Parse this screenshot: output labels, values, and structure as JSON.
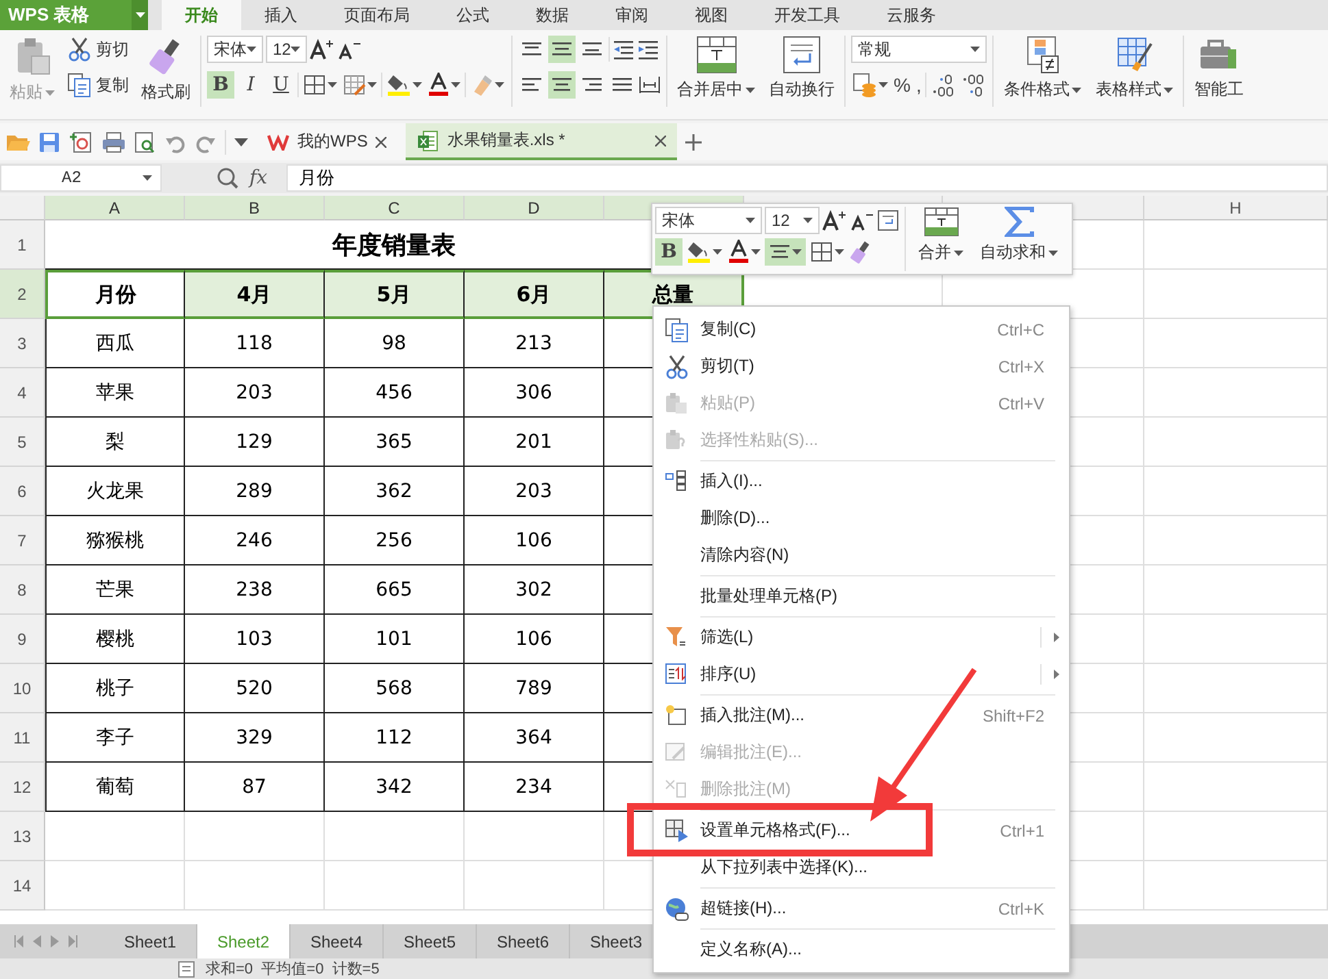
{
  "app_button": {
    "label": "WPS 表格"
  },
  "ribbon_tabs": [
    {
      "label": "开始",
      "selected": true
    },
    {
      "label": "插入",
      "selected": false
    },
    {
      "label": "页面布局",
      "selected": false
    },
    {
      "label": "公式",
      "selected": false
    },
    {
      "label": "数据",
      "selected": false
    },
    {
      "label": "审阅",
      "selected": false
    },
    {
      "label": "视图",
      "selected": false
    },
    {
      "label": "开发工具",
      "selected": false
    },
    {
      "label": "云服务",
      "selected": false
    }
  ],
  "ribbon": {
    "paste": "粘贴",
    "cut": "剪切",
    "copy": "复制",
    "format_painter": "格式刷",
    "font": "宋体",
    "size": "12",
    "font_style_buttons": [
      {
        "label": "B",
        "selected": true
      },
      {
        "label": "I",
        "selected": false
      },
      {
        "label": "U",
        "selected": false
      }
    ],
    "vertical_align": [
      {
        "selected": false
      },
      {
        "selected": true
      },
      {
        "selected": false
      }
    ],
    "horizontal_align": [
      {
        "selected": false
      },
      {
        "selected": true
      },
      {
        "selected": false
      },
      {
        "selected": false
      }
    ],
    "merge": "合并居中",
    "wrap": "自动换行",
    "number_format": "常规",
    "percent": "%",
    "comma": ",",
    "conditional_format": "条件格式",
    "table_style": "表格样式",
    "smart_tools": "智能工"
  },
  "doc_tabs": [
    {
      "label": "我的WPS",
      "selected": false
    },
    {
      "label": "水果销量表.xls *",
      "selected": true
    }
  ],
  "formula_bar": {
    "name_box": "A2",
    "function_label": "fx",
    "formula": "月份"
  },
  "sheet": {
    "columns": [
      {
        "label": "A",
        "selected": true
      },
      {
        "label": "B",
        "selected": true
      },
      {
        "label": "C",
        "selected": true
      },
      {
        "label": "D",
        "selected": true
      },
      {
        "selected": true
      },
      {
        "selected": false
      },
      {
        "selected": false
      },
      {
        "label": "H",
        "selected": false
      }
    ],
    "row_numbers": [
      {
        "label": "1",
        "selected": false
      },
      {
        "label": "2",
        "selected": true
      },
      {
        "label": "3",
        "selected": false
      },
      {
        "label": "4",
        "selected": false
      },
      {
        "label": "5",
        "selected": false
      },
      {
        "label": "6",
        "selected": false
      },
      {
        "label": "7",
        "selected": false
      },
      {
        "label": "8",
        "selected": false
      },
      {
        "label": "9",
        "selected": false
      },
      {
        "label": "10",
        "selected": false
      },
      {
        "label": "11",
        "selected": false
      },
      {
        "label": "12",
        "selected": false
      },
      {
        "label": "13",
        "selected": false
      },
      {
        "label": "14",
        "selected": false
      }
    ],
    "title": "年度销量表",
    "header": {
      "selected": true,
      "cells": [
        "月份",
        "4月",
        "5月",
        "6月",
        "总量"
      ]
    },
    "rows": [
      [
        "西瓜",
        "118",
        "98",
        "213"
      ],
      [
        "苹果",
        "203",
        "456",
        "306"
      ],
      [
        "梨",
        "129",
        "365",
        "201"
      ],
      [
        "火龙果",
        "289",
        "362",
        "203"
      ],
      [
        "猕猴桃",
        "246",
        "256",
        "106"
      ],
      [
        "芒果",
        "238",
        "665",
        "302"
      ],
      [
        "樱桃",
        "103",
        "101",
        "106"
      ],
      [
        "桃子",
        "520",
        "568",
        "789"
      ],
      [
        "李子",
        "329",
        "112",
        "364"
      ],
      [
        "葡萄",
        "87",
        "342",
        "234"
      ]
    ]
  },
  "mini_toolbar": {
    "font": "宋体",
    "size": "12",
    "bold": {
      "label": "B",
      "selected": true
    },
    "align_center": true,
    "merge": "合并",
    "autosum": "自动求和"
  },
  "context_menu": [
    {
      "kind": "item",
      "label": "复制(C)",
      "shortcut": "Ctrl+C",
      "disabled": false,
      "submenu": false
    },
    {
      "kind": "item",
      "label": "剪切(T)",
      "shortcut": "Ctrl+X",
      "disabled": false,
      "submenu": false
    },
    {
      "kind": "item",
      "label": "粘贴(P)",
      "shortcut": "Ctrl+V",
      "disabled": true,
      "submenu": false
    },
    {
      "kind": "item",
      "label": "选择性粘贴(S)...",
      "disabled": true,
      "submenu": false
    },
    {
      "kind": "separator"
    },
    {
      "kind": "item",
      "label": "插入(I)...",
      "disabled": false,
      "submenu": false
    },
    {
      "kind": "item",
      "label": "删除(D)...",
      "disabled": false,
      "submenu": false
    },
    {
      "kind": "item",
      "label": "清除内容(N)",
      "disabled": false,
      "submenu": false
    },
    {
      "kind": "separator"
    },
    {
      "kind": "item",
      "label": "批量处理单元格(P)",
      "disabled": false,
      "submenu": false
    },
    {
      "kind": "separator"
    },
    {
      "kind": "item",
      "label": "筛选(L)",
      "disabled": false,
      "submenu": true
    },
    {
      "kind": "item",
      "label": "排序(U)",
      "disabled": false,
      "submenu": true
    },
    {
      "kind": "separator"
    },
    {
      "kind": "item",
      "label": "插入批注(M)...",
      "shortcut": "Shift+F2",
      "disabled": false,
      "submenu": false
    },
    {
      "kind": "item",
      "label": "编辑批注(E)...",
      "disabled": true,
      "submenu": false
    },
    {
      "kind": "item",
      "label": "删除批注(M)",
      "disabled": true,
      "submenu": false
    },
    {
      "kind": "separator"
    },
    {
      "kind": "item",
      "label": "设置单元格格式(F)...",
      "shortcut": "Ctrl+1",
      "disabled": false,
      "submenu": false
    },
    {
      "kind": "item",
      "label": "从下拉列表中选择(K)...",
      "disabled": false,
      "submenu": false
    },
    {
      "kind": "separator"
    },
    {
      "kind": "item",
      "label": "超链接(H)...",
      "shortcut": "Ctrl+K",
      "disabled": false,
      "submenu": false
    },
    {
      "kind": "separator"
    },
    {
      "kind": "item",
      "label": "定义名称(A)...",
      "disabled": false,
      "submenu": false
    }
  ],
  "sheet_tabs": [
    {
      "label": "Sheet1",
      "selected": false
    },
    {
      "label": "Sheet2",
      "selected": true
    },
    {
      "label": "Sheet4",
      "selected": false
    },
    {
      "label": "Sheet5",
      "selected": false
    },
    {
      "label": "Sheet6",
      "selected": false
    },
    {
      "label": "Sheet3",
      "selected": false
    }
  ],
  "status_bar": {
    "summary": "求和=0  平均值=0  计数=5"
  }
}
